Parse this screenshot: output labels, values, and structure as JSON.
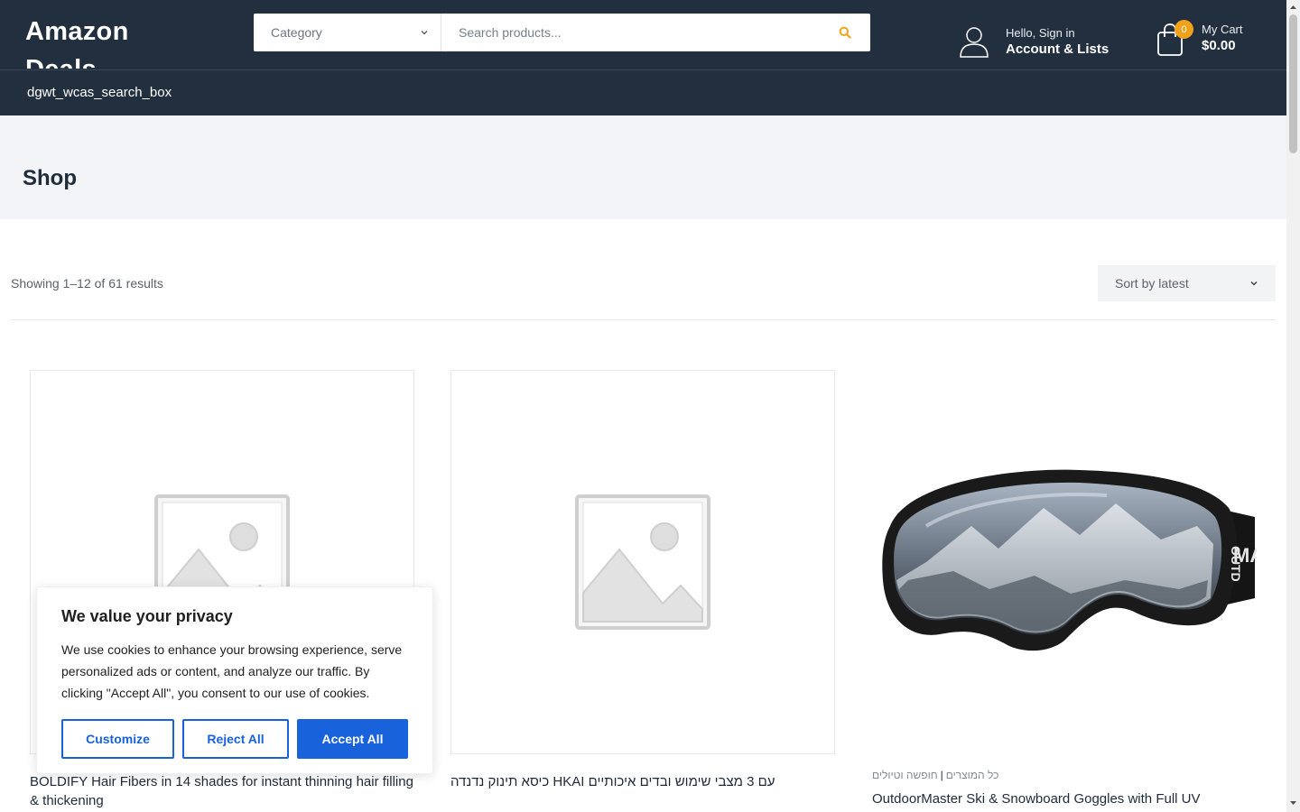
{
  "header": {
    "logo": "Amazon Deals",
    "category_select": "Category",
    "search_placeholder": "Search products...",
    "account": {
      "greeting": "Hello, Sign in",
      "label": "Account & Lists"
    },
    "cart": {
      "count": "0",
      "label": "My Cart",
      "total": "$0.00"
    }
  },
  "subbar": {
    "text": "dgwt_wcas_search_box"
  },
  "page": {
    "title": "Shop"
  },
  "shop": {
    "results": "Showing 1–12 of 61 results",
    "sort": "Sort by latest"
  },
  "products": [
    {
      "name": "BOLDIFY Hair Fibers in 14 shades for instant thinning hair filling & thickening",
      "image": "placeholder-image-icon"
    },
    {
      "name": "כיסא תינוק נדנדה HKAI עם 3 מצבי שימוש ובדים איכותיים",
      "image": "placeholder-image-icon"
    },
    {
      "categories": [
        "כל המוצרים",
        "חופשה וטיולים"
      ],
      "name": "OutdoorMaster Ski & Snowboard Goggles with Full UV",
      "image": "ski-goggles-photo"
    }
  ],
  "cookie": {
    "title": "We value your privacy",
    "text": "We use cookies to enhance your browsing experience, serve personalized ads or content, and analyze our traffic. By clicking \"Accept All\", you consent to our use of cookies.",
    "customize": "Customize",
    "reject": "Reject All",
    "accept": "Accept All"
  },
  "colors": {
    "header_bg": "#212f3f",
    "accent": "#f0a21b",
    "cookie_blue": "#1863dc"
  }
}
